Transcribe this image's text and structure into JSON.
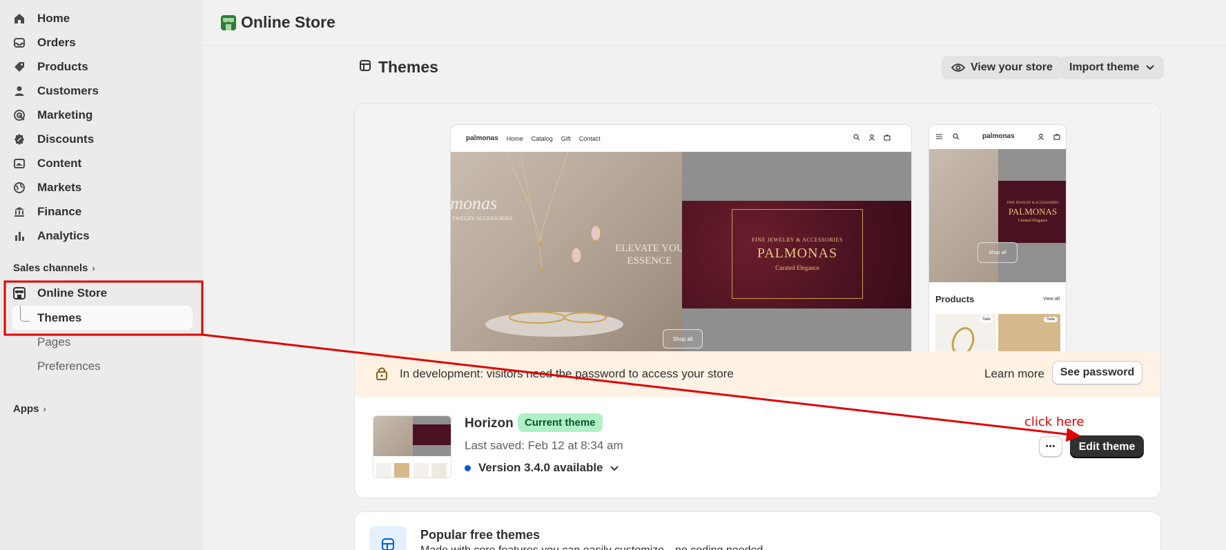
{
  "sidebar": {
    "items": [
      {
        "label": "Home",
        "icon": "home-icon"
      },
      {
        "label": "Orders",
        "icon": "inbox-icon"
      },
      {
        "label": "Products",
        "icon": "tag-icon"
      },
      {
        "label": "Customers",
        "icon": "person-icon"
      },
      {
        "label": "Marketing",
        "icon": "target-icon"
      },
      {
        "label": "Discounts",
        "icon": "discount-icon"
      },
      {
        "label": "Content",
        "icon": "image-icon"
      },
      {
        "label": "Markets",
        "icon": "globe-icon"
      },
      {
        "label": "Finance",
        "icon": "bank-icon"
      },
      {
        "label": "Analytics",
        "icon": "bar-chart-icon"
      }
    ],
    "sales_channels_label": "Sales channels",
    "online_store_label": "Online Store",
    "sub_items": {
      "themes": "Themes",
      "pages": "Pages",
      "preferences": "Preferences"
    },
    "apps_label": "Apps"
  },
  "header": {
    "title": "Online Store"
  },
  "page": {
    "title": "Themes",
    "view_store_label": "View your store",
    "import_theme_label": "Import theme"
  },
  "preview": {
    "desktop": {
      "brand": "palmonas",
      "links": [
        "Home",
        "Catalog",
        "Gift",
        "Contact"
      ],
      "wordmark": "lmonas",
      "wordmark_sub": "EWELRY ACCESSORIES",
      "elevate_line1": "ELEVATE YOU",
      "elevate_line2": "ESSENCE",
      "banner_top": "FINE JEWELRY & ACCESSORIES",
      "banner_title": "PALMONAS",
      "banner_sub": "Curated Elegance",
      "shop_all": "Shop all"
    },
    "mobile": {
      "brand": "palmonas",
      "banner_top": "FINE JEWELRY & ACCESSORIES",
      "banner_title": "PALMONAS",
      "banner_sub": "Curated Elegance",
      "shop_all": "Shop all",
      "products_label": "Products",
      "view_all": "View all",
      "sale_badge": "Sale"
    }
  },
  "dev_banner": {
    "message": "In development: visitors need the password to access your store",
    "learn_more": "Learn more",
    "see_password": "See password"
  },
  "theme": {
    "name": "Horizon",
    "badge": "Current theme",
    "last_saved": "Last saved: Feb 12 at 8:34 am",
    "version": "Version 3.4.0 available",
    "more_label": "•••",
    "edit_label": "Edit theme"
  },
  "popular": {
    "title": "Popular free themes",
    "description": "Made with core features you can easily customize—no coding needed"
  },
  "annotation": {
    "text": "click here",
    "color": "#e00000"
  },
  "colors": {
    "accent": "#303030",
    "badge_bg": "#aff1c5",
    "dev_banner_bg": "#fff1e3",
    "version_dot": "#005bd3"
  }
}
